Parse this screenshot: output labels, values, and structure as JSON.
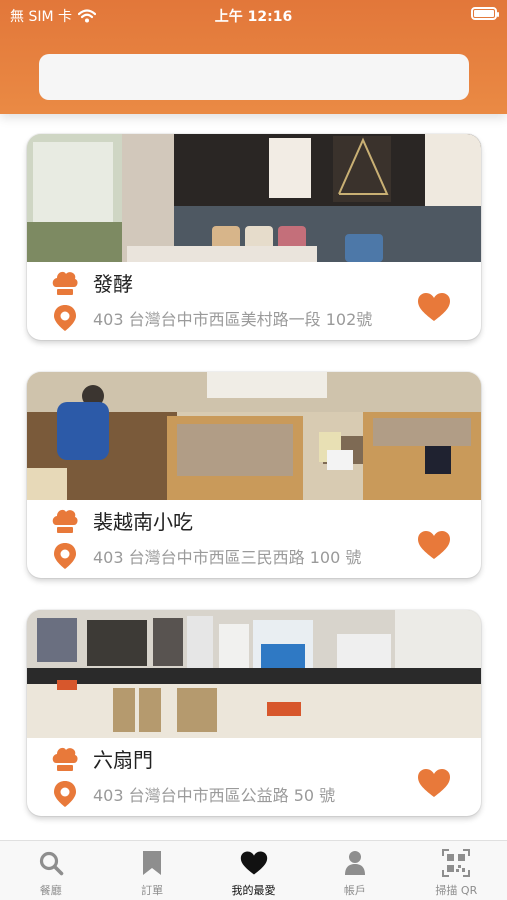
{
  "status_bar": {
    "carrier": "無 SIM 卡",
    "time": "上午 12:16"
  },
  "search": {
    "value": "",
    "placeholder": ""
  },
  "restaurants": [
    {
      "name": "發酵",
      "address": "403 台灣台中市西區美村路一段 102號",
      "favorited": true
    },
    {
      "name": "裴越南小吃",
      "address": "403 台灣台中市西區三民西路 100 號",
      "favorited": true
    },
    {
      "name": "六扇門",
      "address": "403 台灣台中市西區公益路 50 號",
      "favorited": true
    }
  ],
  "tabs": [
    {
      "label": "餐廳",
      "icon": "search-icon",
      "active": false
    },
    {
      "label": "訂單",
      "icon": "bookmark-icon",
      "active": false
    },
    {
      "label": "我的最愛",
      "icon": "heart-icon",
      "active": true
    },
    {
      "label": "帳戶",
      "icon": "person-icon",
      "active": false
    },
    {
      "label": "掃描 QR",
      "icon": "qr-code-icon",
      "active": false
    }
  ],
  "colors": {
    "accent": "#e8793a",
    "favorite": "#e8793a",
    "active_tab": "#111111",
    "inactive_tab": "#8e8e8e"
  }
}
